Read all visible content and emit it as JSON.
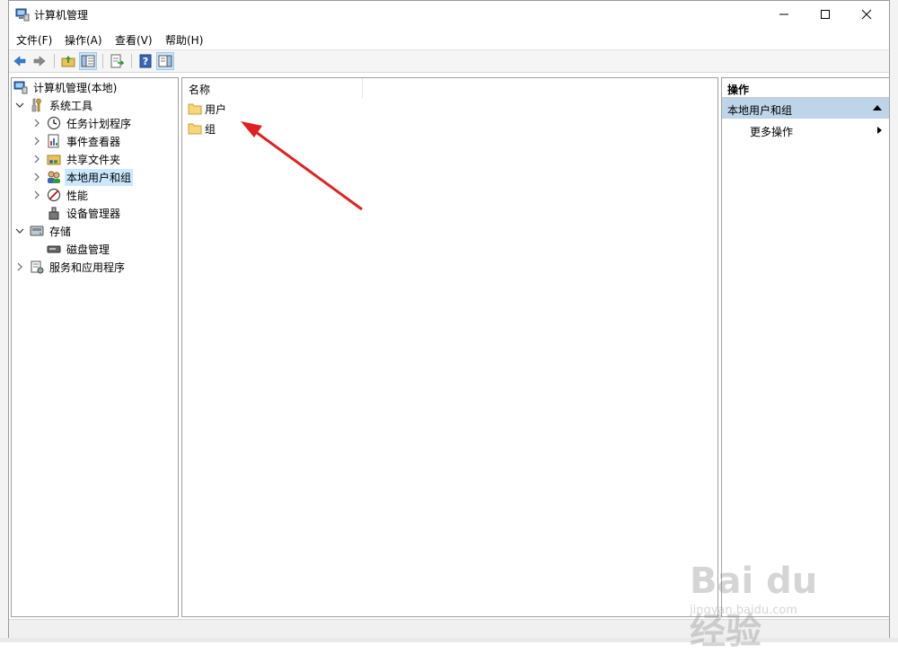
{
  "window": {
    "title": "计算机管理"
  },
  "menu": [
    "文件(F)",
    "操作(A)",
    "查看(V)",
    "帮助(H)"
  ],
  "toolbar": {
    "buttons": [
      "back-icon",
      "forward-icon",
      "up-folder-icon",
      "show-hide-tree-icon",
      "export-list-icon",
      "help-icon",
      "show-hide-action-pane-icon"
    ]
  },
  "tree": {
    "root": "计算机管理(本地)",
    "system_tools": "系统工具",
    "task_scheduler": "任务计划程序",
    "event_viewer": "事件查看器",
    "shared_folders": "共享文件夹",
    "local_users_groups": "本地用户和组",
    "performance": "性能",
    "device_manager": "设备管理器",
    "storage": "存储",
    "disk_management": "磁盘管理",
    "services_apps": "服务和应用程序"
  },
  "list": {
    "column_name": "名称",
    "items": [
      "用户",
      "组"
    ]
  },
  "actions": {
    "header": "操作",
    "group": "本地用户和组",
    "more": "更多操作"
  },
  "watermark": {
    "logo": "Bai du 经验",
    "url": "jingyan.baidu.com"
  },
  "colors": {
    "selection": "#cce8ff",
    "action_group": "#bdd4e9",
    "arrow": "#e02020"
  }
}
